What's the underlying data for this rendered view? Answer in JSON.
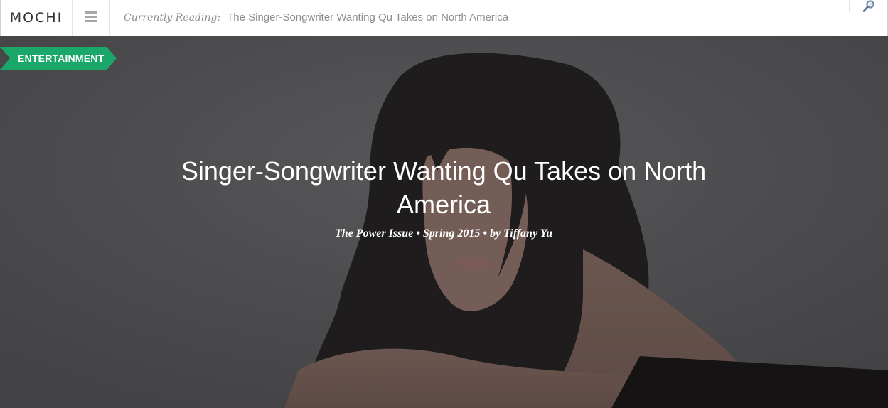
{
  "site": {
    "logo": "MOCHI"
  },
  "header": {
    "currently_label": "Currently Reading:",
    "currently_title": "The Singer-Songwriter Wanting Qu Takes on North America",
    "menu_icon": "hamburger-icon",
    "search_icon": "magnifier-icon"
  },
  "article": {
    "category": "ENTERTAINMENT",
    "headline": "Singer-Songwriter Wanting Qu Takes on North America",
    "issue": "The Power Issue",
    "season": "Spring 2015",
    "by_prefix": "by",
    "author": "Tiffany Yu",
    "separator": "•"
  },
  "colors": {
    "accent": "#1aa76a",
    "overlay": "#4a4a4c",
    "header_text": "#8a8f8c"
  }
}
